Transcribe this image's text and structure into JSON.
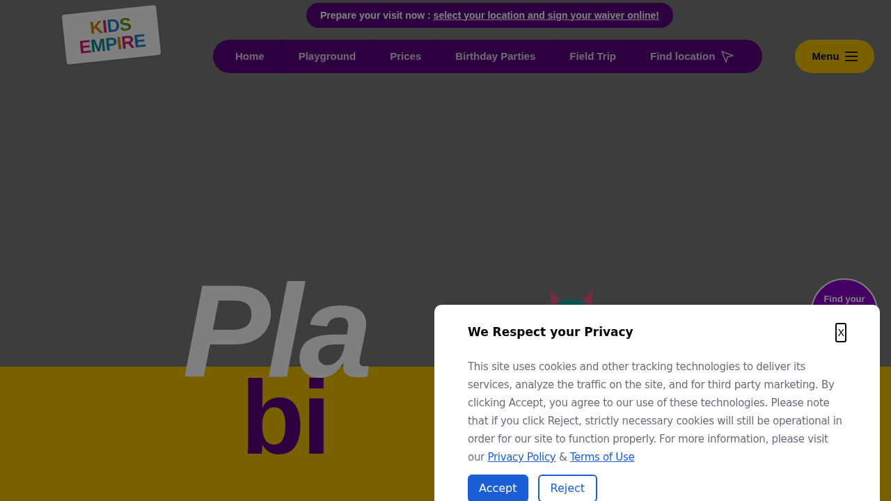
{
  "logo": {
    "lines": [
      "KIDS",
      "EMPIRE"
    ]
  },
  "announcement": {
    "text": "Prepare your visit now : ",
    "link": "select your location and sign your waiver online!"
  },
  "nav": [
    {
      "label": "Home"
    },
    {
      "label": "Playground"
    },
    {
      "label": "Prices"
    },
    {
      "label": "Birthday Parties"
    },
    {
      "label": "Field Trip"
    },
    {
      "label": "Find location",
      "kind": "location"
    }
  ],
  "menu_button": {
    "label": "Menu"
  },
  "hero": {
    "lines": [
      "Pla",
      "bi"
    ]
  },
  "find_badge": {
    "label": "Find your"
  },
  "cookie_dialog": {
    "title": "We Respect your Privacy",
    "close": "X",
    "body": "This site uses cookies and other tracking technologies to deliver its services, analyze the traffic on the site, and for third party marketing. By clicking Accept, you agree to our use of these technologies. Please note that if you click Reject, strictly necessary cookies will still be operational in order for our site to function properly. For more information, please visit our ",
    "privacy_link": "Privacy Policy",
    "separator": " & ",
    "terms_link": "Terms of Use",
    "buttons": [
      {
        "label": "Accept",
        "kind": "primary"
      },
      {
        "label": "Reject",
        "kind": "secondary"
      }
    ]
  }
}
